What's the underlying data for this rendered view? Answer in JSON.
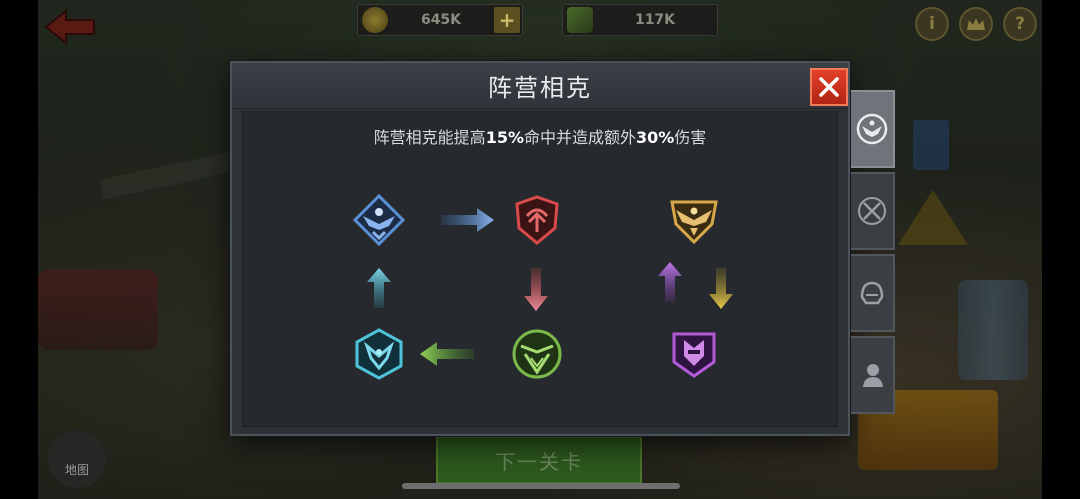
{
  "hud": {
    "coins": "645K",
    "energy": "117K",
    "plus_label": "+",
    "info_label": "i",
    "help_label": "?"
  },
  "dialog": {
    "title": "阵营相克",
    "desc_before": "阵营相克能提高",
    "desc_hit": "15%",
    "desc_middle": "命中并造成额外",
    "desc_damage": "30%",
    "desc_after": "伤害"
  },
  "bottom": {
    "map_label": "地图",
    "next_level_label": "下一关卡"
  },
  "colors": {
    "blue_faction": "#5b8fd6",
    "red_faction": "#d94a4a",
    "green_faction": "#7ab84a",
    "cyan_faction": "#4fc3d9",
    "gold_faction": "#d6a84a",
    "purple_faction": "#b45ad9",
    "close_red": "#c8321e"
  },
  "icons": {
    "back": "back-arrow-icon",
    "coin": "coin-icon",
    "energy": "battery-icon",
    "crown": "crown-icon",
    "map": "map-pin-icon"
  }
}
